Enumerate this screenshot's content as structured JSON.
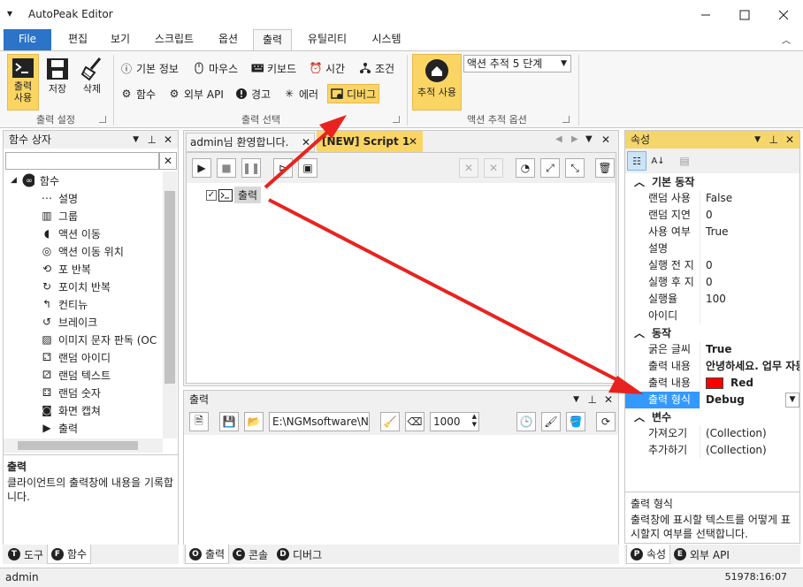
{
  "window": {
    "title": "AutoPeak Editor"
  },
  "ribbon_tabs": [
    "File",
    "편집",
    "보기",
    "스크립트",
    "옵션",
    "출력",
    "유틸리티",
    "시스템"
  ],
  "ribbon": {
    "group1": {
      "label": "출력 설정",
      "btn_output": "출력\n사용",
      "btn_save": "저장",
      "btn_delete": "삭제"
    },
    "group2": {
      "label": "출력 선택",
      "row1": [
        "기본 정보",
        "마우스",
        "키보드",
        "시간",
        "조건"
      ],
      "row2": [
        "함수",
        "외부 API",
        "경고",
        "에러",
        "디버그"
      ]
    },
    "group3": {
      "label": "액션 추적 옵션",
      "btn_track": "추적 사용",
      "select_value": "액션 추적 5 단계"
    }
  },
  "func_panel": {
    "title": "함수 상자",
    "search_placeholder": "",
    "root": "함수",
    "items": [
      {
        "label": "설명",
        "icon": "ellipsis-circle-icon"
      },
      {
        "label": "그룹",
        "icon": "books-icon"
      },
      {
        "label": "액션 이동",
        "icon": "pacman-icon"
      },
      {
        "label": "액션 이동 위치",
        "icon": "target-icon"
      },
      {
        "label": "포 반복",
        "icon": "loop-icon"
      },
      {
        "label": "포이치 반복",
        "icon": "refresh-icon"
      },
      {
        "label": "컨티뉴",
        "icon": "return-arrow-icon"
      },
      {
        "label": "브레이크",
        "icon": "break-arrow-icon"
      },
      {
        "label": "이미지 문자 판독 (OC",
        "icon": "ocr-icon"
      },
      {
        "label": "랜덤 아이디",
        "icon": "random-id-icon"
      },
      {
        "label": "랜덤 텍스트",
        "icon": "random-text-icon"
      },
      {
        "label": "랜덤 숫자",
        "icon": "random-number-icon"
      },
      {
        "label": "화면 캡쳐",
        "icon": "camera-icon"
      },
      {
        "label": "출력",
        "icon": "terminal-icon"
      }
    ],
    "desc_title": "출력",
    "desc_text": "클라이언트의 출력창에 내용을 기록합니다.",
    "tabs": [
      {
        "badge": "T",
        "label": "도구"
      },
      {
        "badge": "F",
        "label": "함수"
      }
    ]
  },
  "editor": {
    "tabs": [
      "admin님 환영합니다.",
      "[NEW] Script 1"
    ],
    "node_label": "출력"
  },
  "output_panel": {
    "title": "출력",
    "path": "E:\\NGMsoftware\\NG",
    "max_lines": "1000",
    "tabs": [
      {
        "badge": "O",
        "label": "출력"
      },
      {
        "badge": "C",
        "label": "콘솔"
      },
      {
        "badge": "D",
        "label": "디버그"
      }
    ]
  },
  "props": {
    "title": "속성",
    "cat1": "기본 동작",
    "rows1": [
      {
        "k": "랜덤 사용",
        "v": "False"
      },
      {
        "k": "랜덤 지연",
        "v": "0"
      },
      {
        "k": "사용 여부",
        "v": "True"
      },
      {
        "k": "설명",
        "v": ""
      },
      {
        "k": "실행 전 지",
        "v": "0"
      },
      {
        "k": "실행 후 지",
        "v": "0"
      },
      {
        "k": "실행율",
        "v": "100"
      },
      {
        "k": "아이디",
        "v": ""
      }
    ],
    "cat2": "동작",
    "rows2": [
      {
        "k": "굵은 글씨",
        "v": "True"
      },
      {
        "k": "출력 내용",
        "v": "안녕하세요. 업무 자동"
      },
      {
        "k": "출력 내용",
        "v": "Red"
      },
      {
        "k": "출력 형식",
        "v": "Debug"
      }
    ],
    "cat3": "변수",
    "rows3": [
      {
        "k": "가져오기",
        "v": "(Collection)"
      },
      {
        "k": "추가하기",
        "v": "(Collection)"
      }
    ],
    "desc_title": "출력 형식",
    "desc_text": "출력창에 표시할 텍스트를 어떻게 표시할지 여부를 선택합니다.",
    "tabs": [
      {
        "badge": "P",
        "label": "속성"
      },
      {
        "badge": "E",
        "label": "외부 API"
      }
    ]
  },
  "status": {
    "user": "admin",
    "time": "51978:16:07"
  },
  "colors": {
    "file_tab": "#2b74c7",
    "selected": "#fbd564",
    "arrow": "#e8231f",
    "swatch": "#ff0000"
  }
}
